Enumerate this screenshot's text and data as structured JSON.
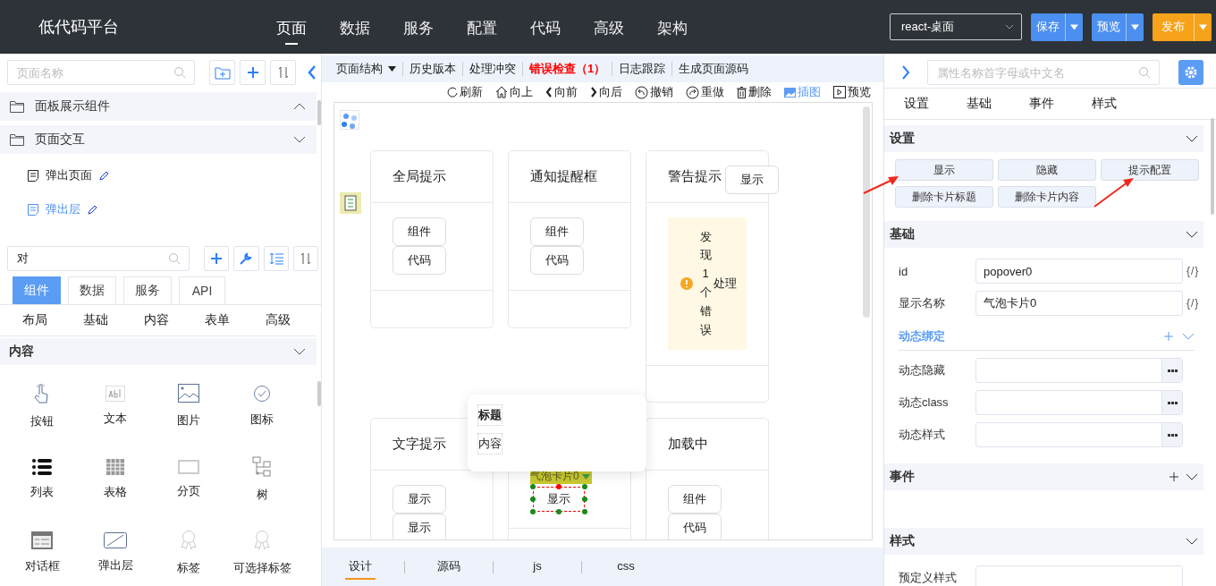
{
  "header": {
    "logo": "低代码平台",
    "nav": [
      {
        "label": "页面",
        "selected": true
      },
      {
        "label": "数据",
        "selected": false
      },
      {
        "label": "服务",
        "selected": false
      },
      {
        "label": "配置",
        "selected": false
      },
      {
        "label": "代码",
        "selected": false
      },
      {
        "label": "高级",
        "selected": false
      },
      {
        "label": "架构",
        "selected": false
      }
    ],
    "platform_select": {
      "value": "react-桌面"
    },
    "actions": [
      {
        "label": "保存",
        "kind": "primary"
      },
      {
        "label": "预览",
        "kind": "primary"
      },
      {
        "label": "发布",
        "kind": "warning"
      }
    ]
  },
  "left_panel": {
    "page_search": {
      "placeholder": "页面名称"
    },
    "page_tree": [
      {
        "label": "面板展示组件",
        "expanded": false
      },
      {
        "label": "页面交互",
        "expanded": true,
        "children": [
          {
            "label": "弹出页面",
            "selected": false
          },
          {
            "label": "弹出层",
            "selected": true
          }
        ]
      }
    ],
    "component_search": {
      "value": "对"
    },
    "tabs": [
      {
        "label": "组件",
        "selected": true
      },
      {
        "label": "数据",
        "selected": false
      },
      {
        "label": "服务",
        "selected": false
      },
      {
        "label": "API",
        "selected": false
      }
    ],
    "categories": [
      "布局",
      "基础",
      "内容",
      "表单",
      "高级"
    ],
    "section": {
      "title": "内容",
      "expanded": true
    },
    "components": [
      {
        "label": "按钮",
        "kind": "pointer"
      },
      {
        "label": "文本",
        "kind": "text"
      },
      {
        "label": "图片",
        "kind": "image"
      },
      {
        "label": "图标",
        "kind": "check"
      },
      {
        "label": "列表",
        "kind": "list"
      },
      {
        "label": "表格",
        "kind": "table"
      },
      {
        "label": "分页",
        "kind": "rect"
      },
      {
        "label": "树",
        "kind": "tree"
      },
      {
        "label": "对话框",
        "kind": "dialog"
      },
      {
        "label": "弹出层",
        "kind": "slash"
      },
      {
        "label": "标签",
        "kind": "ribbon"
      },
      {
        "label": "可选择标签",
        "kind": "ribbon"
      }
    ]
  },
  "editor": {
    "menu": [
      {
        "label": "页面结构",
        "kind": "dropdown"
      },
      {
        "label": "历史版本",
        "kind": "plain"
      },
      {
        "label": "处理冲突",
        "kind": "plain"
      },
      {
        "label": "错误检查（1）",
        "kind": "error"
      },
      {
        "label": "日志跟踪",
        "kind": "plain"
      },
      {
        "label": "生成页面源码",
        "kind": "plain"
      }
    ],
    "actions": [
      {
        "label": "刷新",
        "kind": "refresh",
        "selected": false
      },
      {
        "label": "向上",
        "kind": "home",
        "selected": false
      },
      {
        "label": "向前",
        "kind": "left",
        "selected": false
      },
      {
        "label": "向后",
        "kind": "right",
        "selected": false
      },
      {
        "label": "撤销",
        "kind": "undo",
        "selected": false
      },
      {
        "label": "重做",
        "kind": "redo",
        "selected": false
      },
      {
        "label": "删除",
        "kind": "trash",
        "selected": false
      },
      {
        "label": "插图",
        "kind": "picture",
        "selected": true
      },
      {
        "label": "预览",
        "kind": "play",
        "selected": false
      }
    ],
    "canvas": {
      "cards": [
        {
          "kind": "buttons",
          "title": "全局提示",
          "buttons": [
            "组件",
            "代码"
          ]
        },
        {
          "kind": "buttons",
          "title": "通知提醒框",
          "buttons": [
            "组件",
            "代码"
          ]
        },
        {
          "kind": "alert",
          "title": "警告提示",
          "overlay_button": "显示",
          "alert": {
            "message": "发现1个错误",
            "action": "处理"
          }
        },
        {
          "kind": "buttons",
          "title": "文字提示",
          "buttons": [
            "显示",
            "显示"
          ]
        },
        {
          "kind": "selected",
          "tag": "气泡卡片0",
          "button": "显示"
        },
        {
          "kind": "buttons",
          "title": "加载中",
          "buttons": [
            "组件",
            "代码"
          ]
        }
      ],
      "popover": {
        "title": "标题",
        "content": "内容"
      }
    },
    "bottom_tabs": [
      {
        "label": "设计",
        "selected": true
      },
      {
        "label": "源码",
        "selected": false
      },
      {
        "label": "js",
        "selected": false
      },
      {
        "label": "css",
        "selected": false
      }
    ]
  },
  "right_panel": {
    "search": {
      "placeholder": "属性名称首字母或中文名"
    },
    "tabs": [
      "设置",
      "基础",
      "事件",
      "样式"
    ],
    "sections": [
      {
        "kind": "buttons",
        "title": "设置",
        "addable": false,
        "buttons": [
          "显示",
          "隐藏",
          "提示配置",
          "删除卡片标题",
          "删除卡片内容"
        ]
      },
      {
        "kind": "fields",
        "title": "基础",
        "addable": false,
        "fields": [
          {
            "label": "id",
            "value": "popover0",
            "binding": "{/}"
          },
          {
            "label": "显示名称",
            "value": "气泡卡片0",
            "binding": "{/}"
          }
        ],
        "subsection": {
          "title": "动态绑定",
          "addable": true,
          "fields": [
            {
              "label": "动态隐藏"
            },
            {
              "label": "动态class"
            },
            {
              "label": "动态样式"
            }
          ]
        }
      },
      {
        "kind": "empty",
        "title": "事件",
        "addable": true
      },
      {
        "kind": "fields",
        "title": "样式",
        "addable": false,
        "fields": [
          {
            "label": "预定义样式"
          }
        ]
      }
    ]
  }
}
